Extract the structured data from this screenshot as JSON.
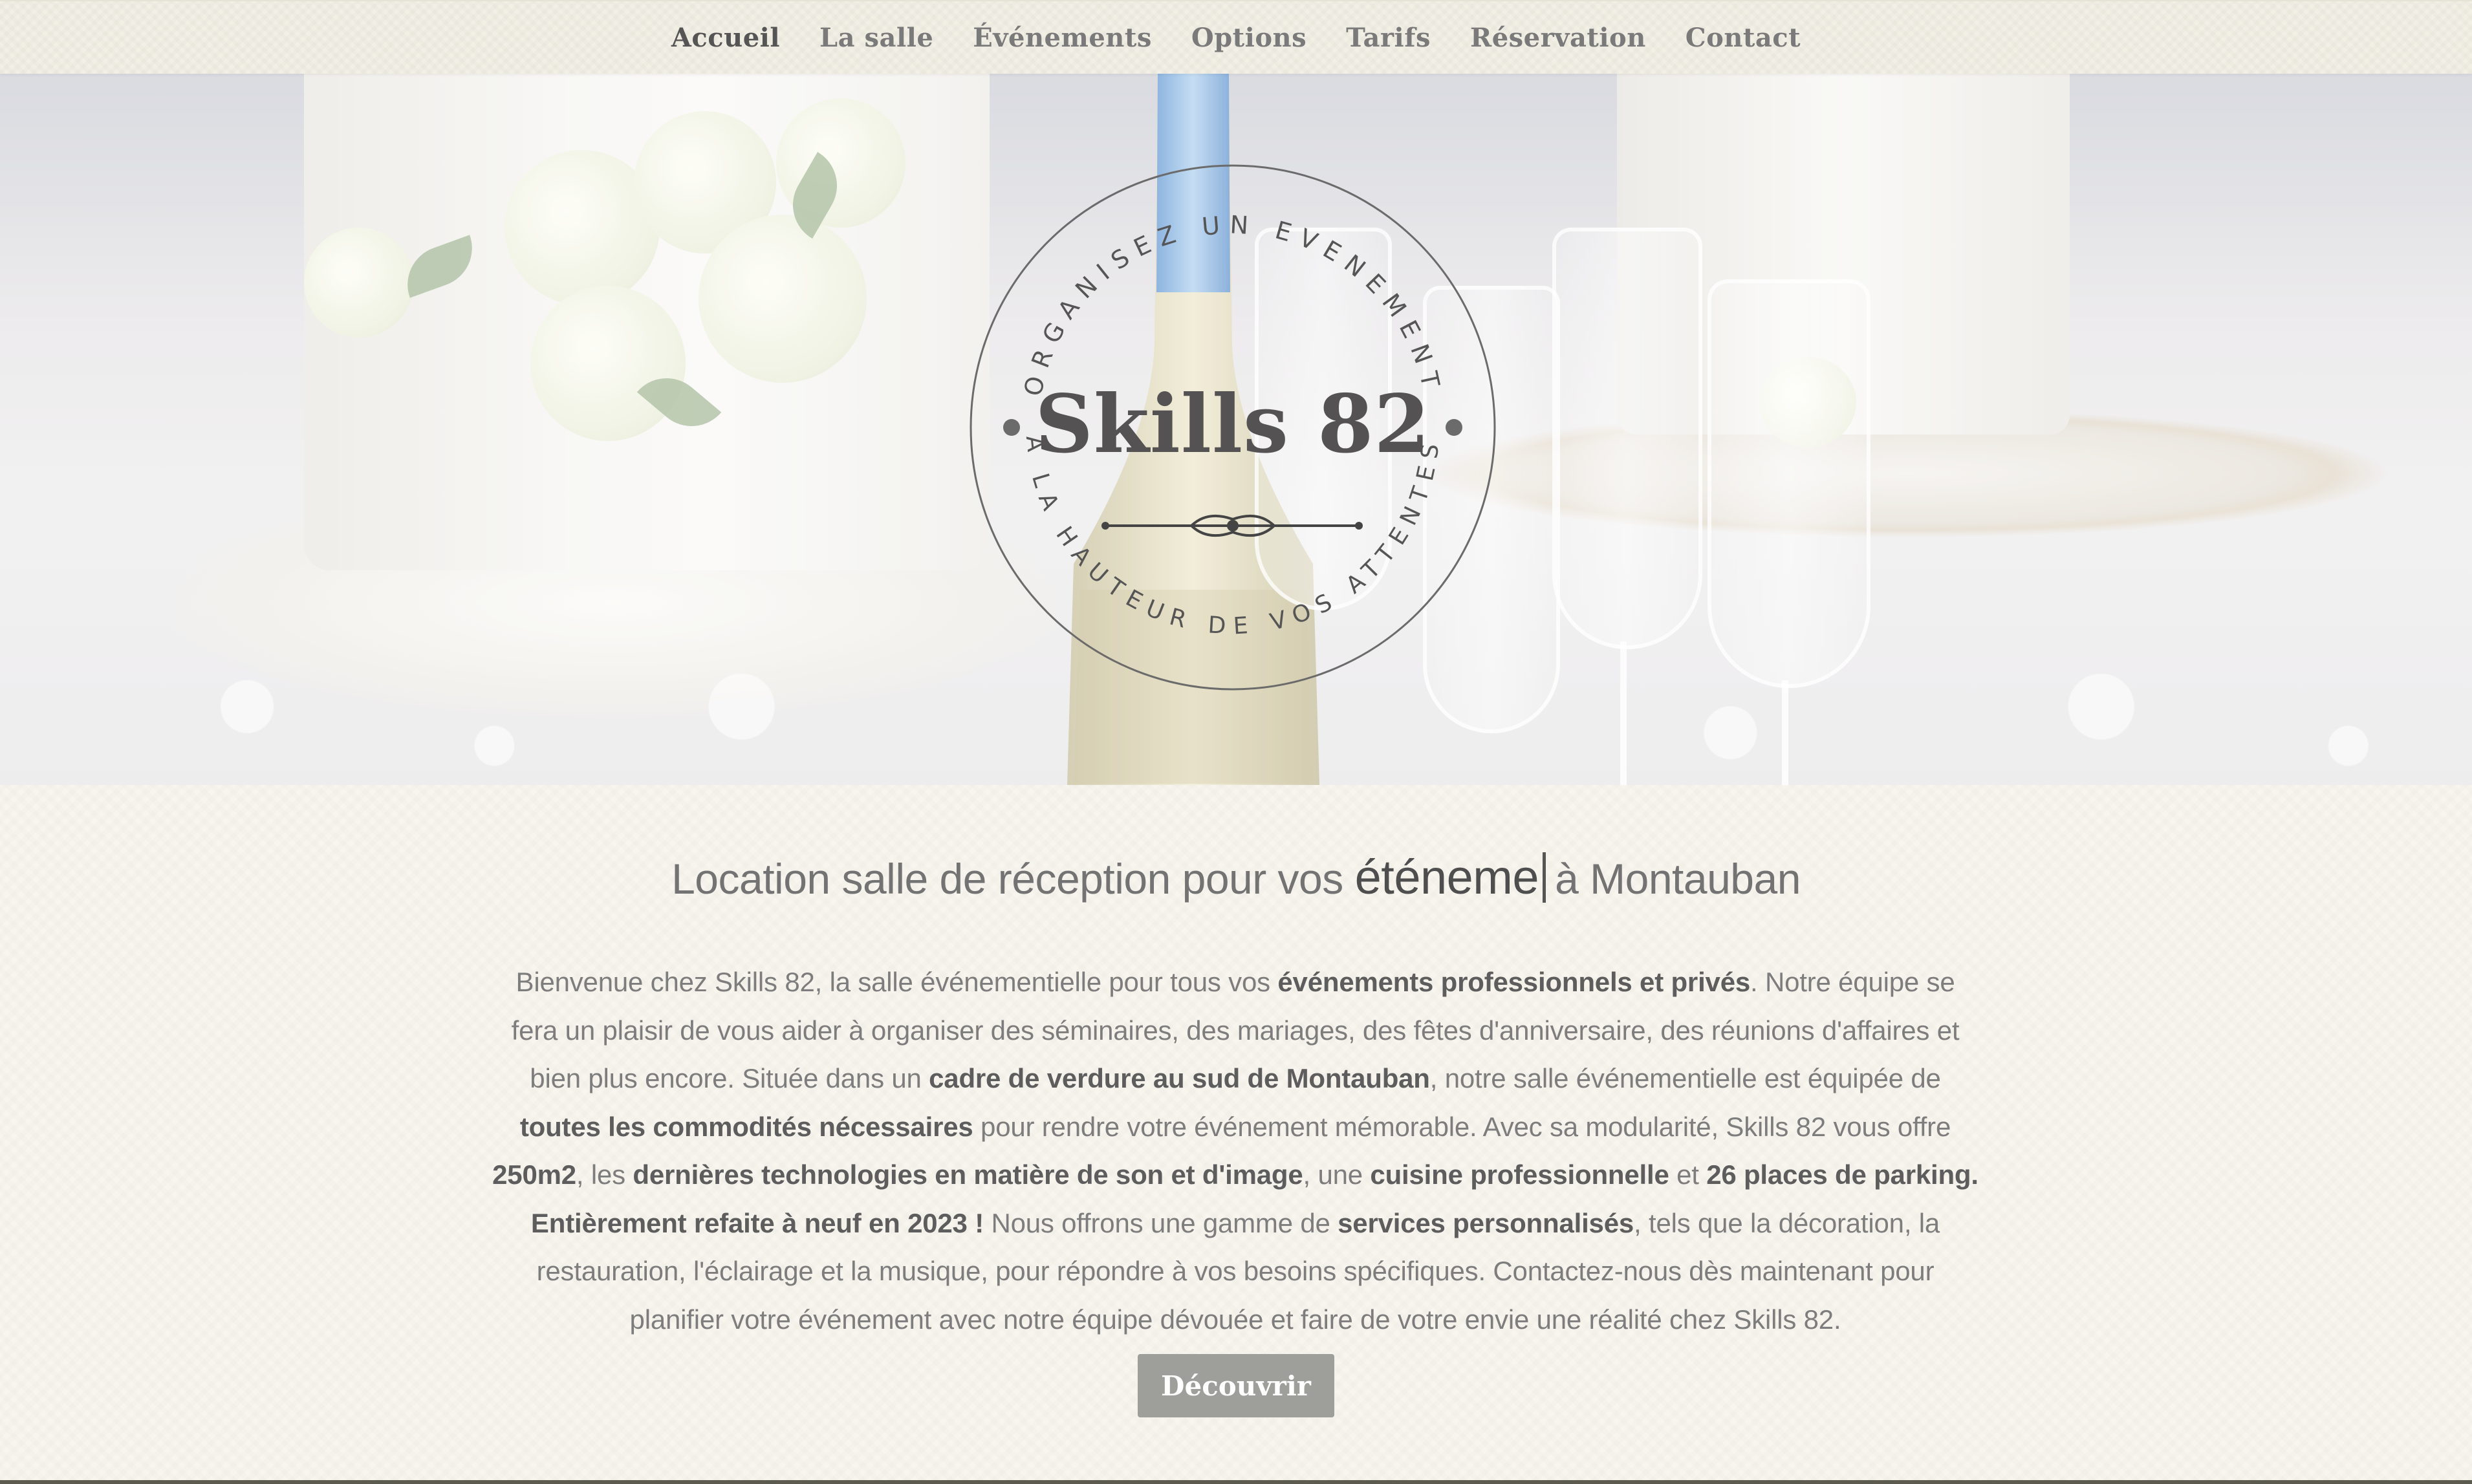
{
  "nav": {
    "items": [
      {
        "label": "Accueil",
        "active": true
      },
      {
        "label": "La salle"
      },
      {
        "label": "Événements"
      },
      {
        "label": "Options"
      },
      {
        "label": "Tarifs"
      },
      {
        "label": "Réservation"
      },
      {
        "label": "Contact"
      }
    ]
  },
  "hero": {
    "emblem_title": "Skills 82",
    "emblem_top_text": "ORGANISEZ UN EVENEMENT",
    "emblem_bottom_text": "A LA HAUTEUR DE VOS ATTENTES"
  },
  "main": {
    "headline_prefix": "Location salle de réception pour vos",
    "headline_typed": "éténeme",
    "headline_suffix": "à Montauban",
    "paragraph": [
      {
        "t": "Bienvenue chez Skills 82, la salle événementielle pour tous vos "
      },
      {
        "t": "événements professionnels et privés",
        "b": true
      },
      {
        "t": ". Notre équipe se fera un plaisir de vous aider à organiser des séminaires, des mariages, des fêtes d'anniversaire, des réunions d'affaires et bien plus encore. Située dans un "
      },
      {
        "t": "cadre de verdure au sud de Montauban",
        "b": true
      },
      {
        "t": ", notre salle événementielle est équipée de "
      },
      {
        "t": "toutes les commodités nécessaires",
        "b": true
      },
      {
        "t": " pour rendre votre événement mémorable. Avec sa modularité, Skills 82 vous offre "
      },
      {
        "t": "250m2",
        "b": true
      },
      {
        "t": ", les "
      },
      {
        "t": "dernières technologies en matière de son et d'image",
        "b": true
      },
      {
        "t": ", une "
      },
      {
        "t": "cuisine professionnelle",
        "b": true
      },
      {
        "t": " et "
      },
      {
        "t": "26 places de parking. Entièrement refaite à neuf en 2023 !",
        "b": true
      },
      {
        "t": " Nous offrons une gamme de "
      },
      {
        "t": "services personnalisés",
        "b": true
      },
      {
        "t": ", tels que la décoration, la restauration, l'éclairage et la musique, pour répondre à vos besoins spécifiques. Contactez-nous dès maintenant pour planifier votre événement avec notre équipe dévouée et faire de votre envie une réalité chez Skills 82."
      }
    ],
    "cta_label": "Découvrir"
  }
}
